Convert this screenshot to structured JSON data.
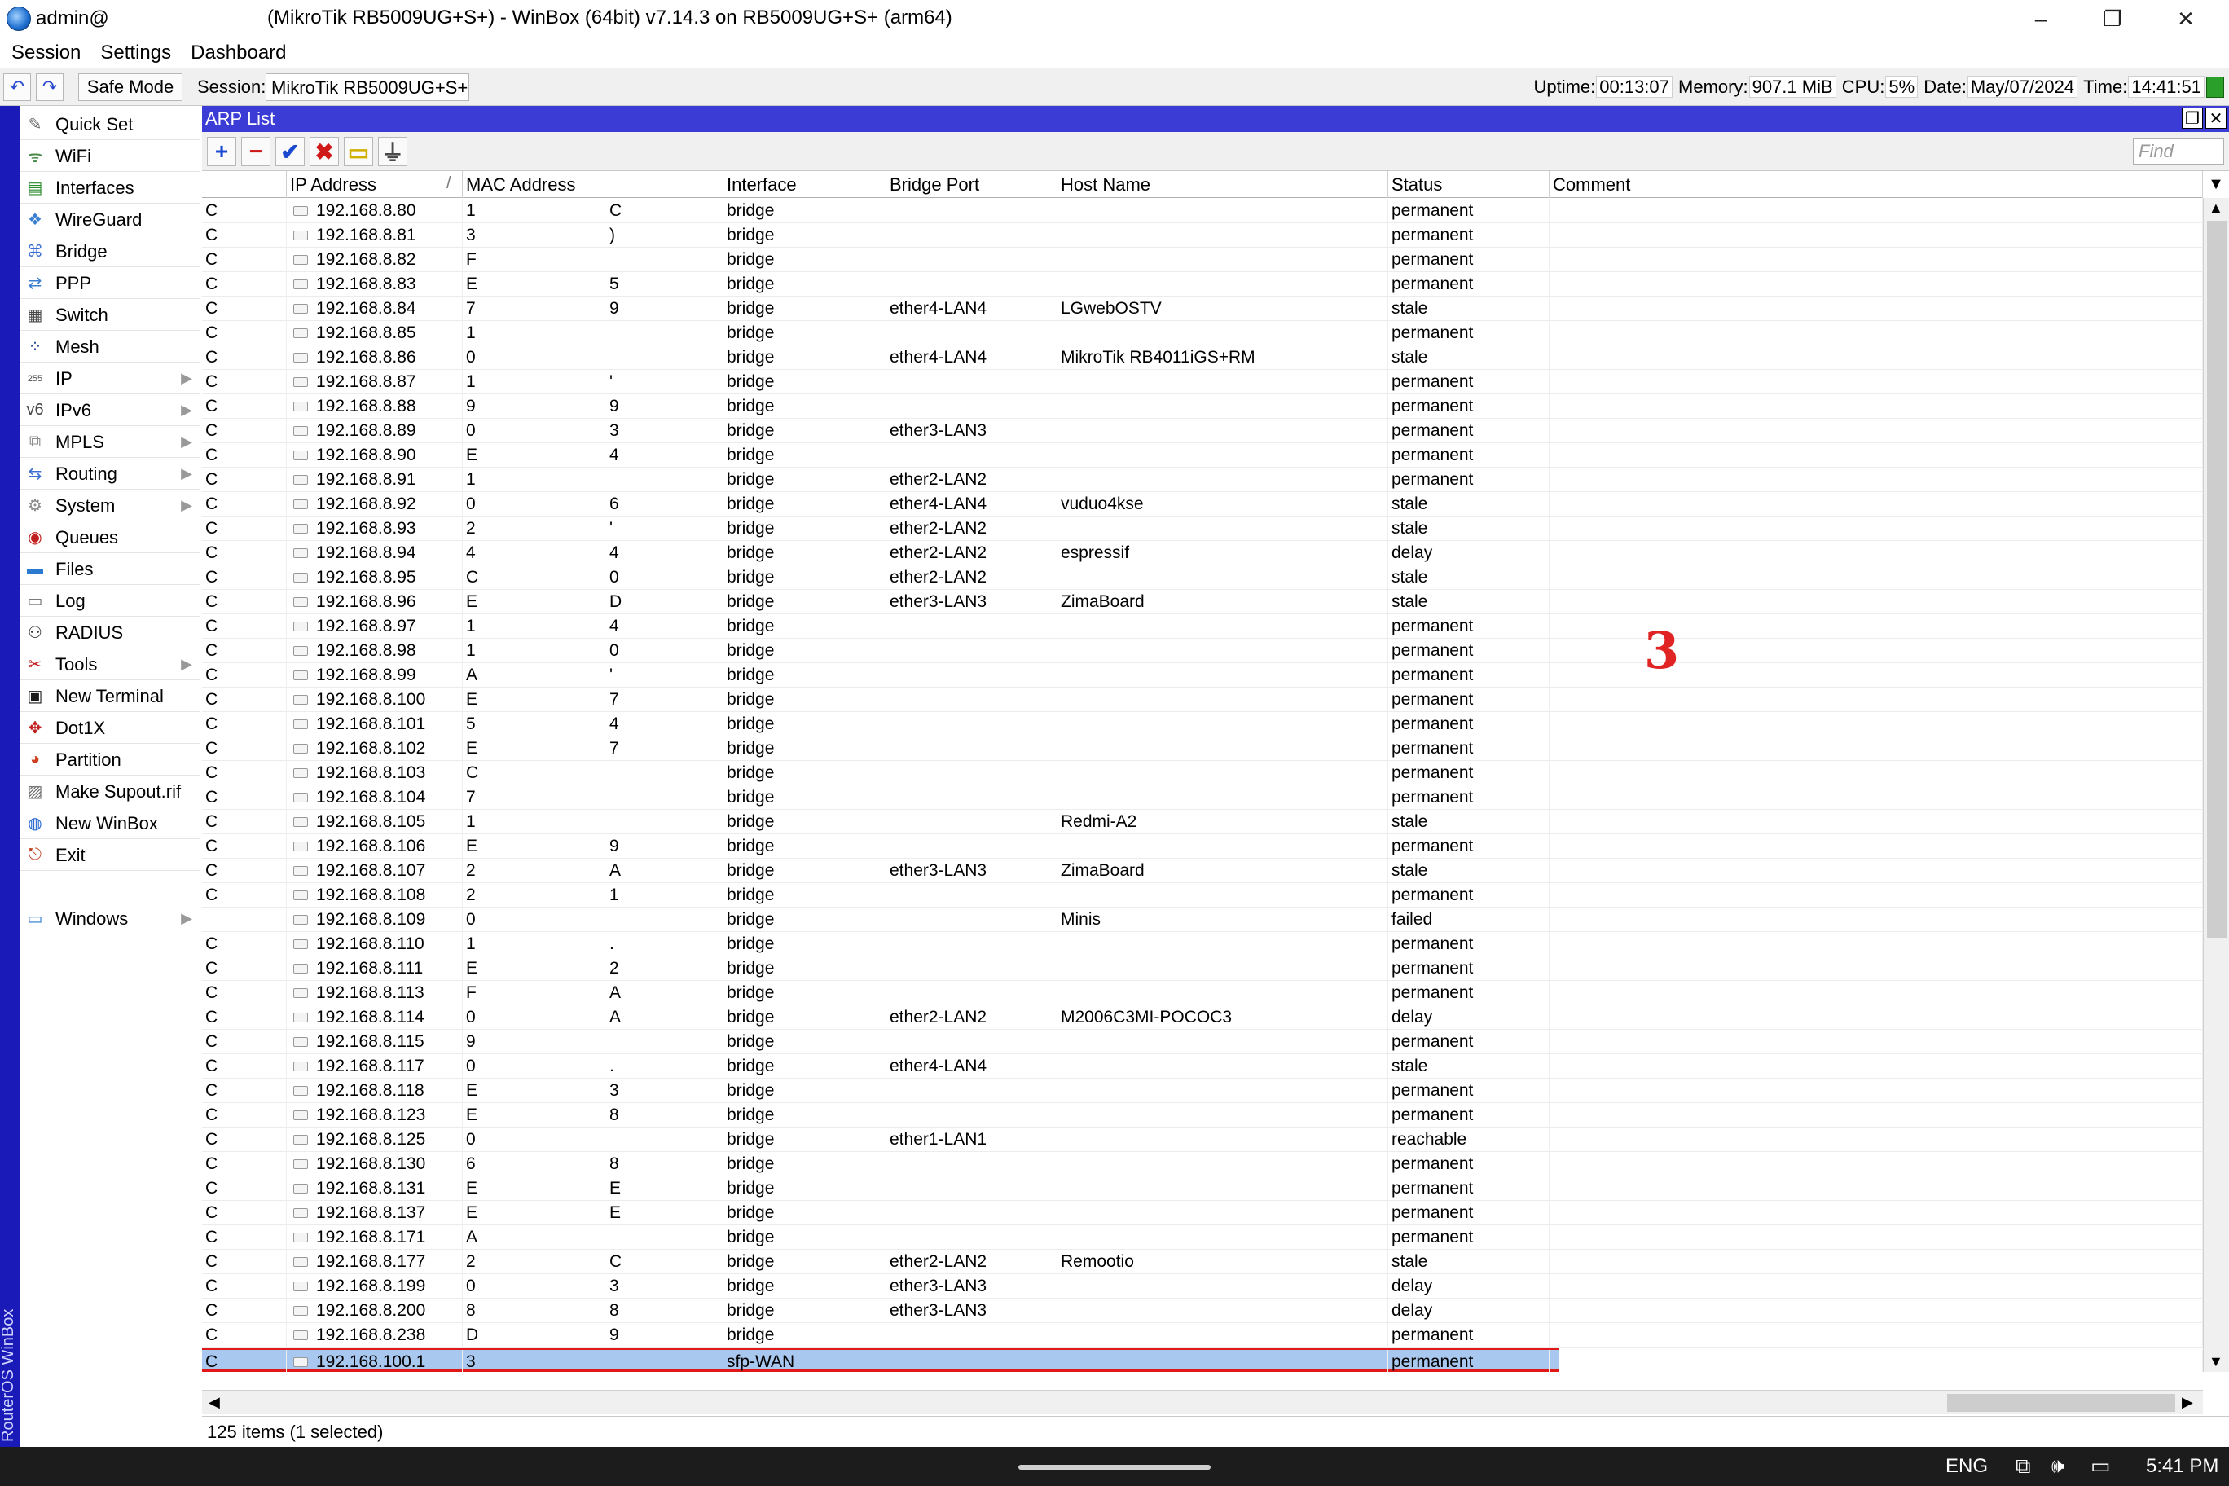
{
  "window": {
    "user": "admin@",
    "title": "(MikroTik RB5009UG+S+) - WinBox (64bit) v7.14.3 on RB5009UG+S+ (arm64)",
    "minimize": "–",
    "maximize": "❐",
    "close": "✕"
  },
  "menu": [
    "Session",
    "Settings",
    "Dashboard"
  ],
  "toolbar": {
    "undo": "↶",
    "redo": "↷",
    "safe_mode": "Safe Mode",
    "session_label": "Session:",
    "session_value": "MikroTik RB5009UG+S+",
    "uptime_label": "Uptime:",
    "uptime": "00:13:07",
    "memory_label": "Memory:",
    "memory": "907.1 MiB",
    "cpu_label": "CPU:",
    "cpu": "5%",
    "date_label": "Date:",
    "date": "May/07/2024",
    "time_label": "Time:",
    "time": "14:41:51",
    "led_color": "#2aa02a"
  },
  "side_stripe": "RouterOS WinBox",
  "sidebar": [
    {
      "label": "Quick Set",
      "icon": "quick-set-icon",
      "glyph": "✎",
      "color": "#6a6a6a",
      "submenu": false
    },
    {
      "label": "WiFi",
      "icon": "wifi-icon",
      "glyph": "ᯤ",
      "color": "#4a8a4a",
      "submenu": false
    },
    {
      "label": "Interfaces",
      "icon": "interfaces-icon",
      "glyph": "▤",
      "color": "#2b8a2b",
      "submenu": false
    },
    {
      "label": "WireGuard",
      "icon": "wireguard-icon",
      "glyph": "❖",
      "color": "#3b7fd0",
      "submenu": false
    },
    {
      "label": "Bridge",
      "icon": "bridge-icon",
      "glyph": "⌘",
      "color": "#3b6fd0",
      "submenu": false
    },
    {
      "label": "PPP",
      "icon": "ppp-icon",
      "glyph": "⇄",
      "color": "#3b7fd0",
      "submenu": false
    },
    {
      "label": "Switch",
      "icon": "switch-icon",
      "glyph": "▦",
      "color": "#4a4a4a",
      "submenu": false
    },
    {
      "label": "Mesh",
      "icon": "mesh-icon",
      "glyph": "⁘",
      "color": "#2a4aa0",
      "submenu": false
    },
    {
      "label": "IP",
      "icon": "ip-icon",
      "glyph": "255",
      "color": "#4a4a4a",
      "submenu": true
    },
    {
      "label": "IPv6",
      "icon": "ipv6-icon",
      "glyph": "v6",
      "color": "#4a4a4a",
      "submenu": true
    },
    {
      "label": "MPLS",
      "icon": "mpls-icon",
      "glyph": "⧉",
      "color": "#8a8a8a",
      "submenu": true
    },
    {
      "label": "Routing",
      "icon": "routing-icon",
      "glyph": "⇆",
      "color": "#3b6fd0",
      "submenu": true
    },
    {
      "label": "System",
      "icon": "system-icon",
      "glyph": "⚙",
      "color": "#8a8a8a",
      "submenu": true
    },
    {
      "label": "Queues",
      "icon": "queues-icon",
      "glyph": "◉",
      "color": "#c02020",
      "submenu": false
    },
    {
      "label": "Files",
      "icon": "files-icon",
      "glyph": "▬",
      "color": "#2a7ad0",
      "submenu": false
    },
    {
      "label": "Log",
      "icon": "log-icon",
      "glyph": "▭",
      "color": "#6a6a6a",
      "submenu": false
    },
    {
      "label": "RADIUS",
      "icon": "radius-icon",
      "glyph": "⚇",
      "color": "#3a3a3a",
      "submenu": false
    },
    {
      "label": "Tools",
      "icon": "tools-icon",
      "glyph": "✂",
      "color": "#c02020",
      "submenu": true
    },
    {
      "label": "New Terminal",
      "icon": "terminal-icon",
      "glyph": "▣",
      "color": "#1a1a1a",
      "submenu": false
    },
    {
      "label": "Dot1X",
      "icon": "dot1x-icon",
      "glyph": "✥",
      "color": "#c02020",
      "submenu": false
    },
    {
      "label": "Partition",
      "icon": "partition-icon",
      "glyph": "◕",
      "color": "#d04020",
      "submenu": false
    },
    {
      "label": "Make Supout.rif",
      "icon": "supout-icon",
      "glyph": "▨",
      "color": "#6a6a6a",
      "submenu": false
    },
    {
      "label": "New WinBox",
      "icon": "new-winbox-icon",
      "glyph": "◍",
      "color": "#2a6ad0",
      "submenu": false
    },
    {
      "label": "Exit",
      "icon": "exit-icon",
      "glyph": "⎋",
      "color": "#c04020",
      "submenu": false
    },
    {
      "label": "",
      "icon": "",
      "glyph": "",
      "color": "#000",
      "submenu": false
    },
    {
      "label": "Windows",
      "icon": "windows-icon",
      "glyph": "▭",
      "color": "#2a7ad0",
      "submenu": true
    }
  ],
  "arp": {
    "title": "ARP List",
    "restore": "❐",
    "close": "✕",
    "find_placeholder": "Find",
    "buttons": [
      {
        "name": "add-button",
        "glyph": "+",
        "color": "#1a4ad0"
      },
      {
        "name": "remove-button",
        "glyph": "−",
        "color": "#d01a1a"
      },
      {
        "name": "enable-button",
        "glyph": "✔",
        "color": "#1a4ad0"
      },
      {
        "name": "disable-button",
        "glyph": "✖",
        "color": "#d01a1a"
      },
      {
        "name": "comment-button",
        "glyph": "▭",
        "color": "#d0b000"
      },
      {
        "name": "filter-button",
        "glyph": "⏚",
        "color": "#4a4a4a"
      }
    ],
    "columns": [
      "",
      "IP Address",
      "MAC Address",
      "Interface",
      "Bridge Port",
      "Host Name",
      "Status",
      "Comment"
    ],
    "sort_mark": "/",
    "rows": [
      {
        "flag": "C",
        "ip": "192.168.8.80",
        "mac_start": "1",
        "mac_end": "C",
        "iface": "bridge",
        "port": "",
        "host": "",
        "status": "permanent"
      },
      {
        "flag": "C",
        "ip": "192.168.8.81",
        "mac_start": "3",
        "mac_end": ")",
        "iface": "bridge",
        "port": "",
        "host": "",
        "status": "permanent"
      },
      {
        "flag": "C",
        "ip": "192.168.8.82",
        "mac_start": "F",
        "mac_end": "",
        "iface": "bridge",
        "port": "",
        "host": "",
        "status": "permanent"
      },
      {
        "flag": "C",
        "ip": "192.168.8.83",
        "mac_start": "E",
        "mac_end": "5",
        "iface": "bridge",
        "port": "",
        "host": "",
        "status": "permanent"
      },
      {
        "flag": "C",
        "ip": "192.168.8.84",
        "mac_start": "7",
        "mac_end": "9",
        "iface": "bridge",
        "port": "ether4-LAN4",
        "host": "LGwebOSTV",
        "status": "stale"
      },
      {
        "flag": "C",
        "ip": "192.168.8.85",
        "mac_start": "1",
        "mac_end": "",
        "iface": "bridge",
        "port": "",
        "host": "",
        "status": "permanent"
      },
      {
        "flag": "C",
        "ip": "192.168.8.86",
        "mac_start": "0",
        "mac_end": "",
        "iface": "bridge",
        "port": "ether4-LAN4",
        "host": "MikroTik RB4011iGS+RM",
        "status": "stale"
      },
      {
        "flag": "C",
        "ip": "192.168.8.87",
        "mac_start": "1",
        "mac_end": "'",
        "iface": "bridge",
        "port": "",
        "host": "",
        "status": "permanent"
      },
      {
        "flag": "C",
        "ip": "192.168.8.88",
        "mac_start": "9",
        "mac_end": "9",
        "iface": "bridge",
        "port": "",
        "host": "",
        "status": "permanent"
      },
      {
        "flag": "C",
        "ip": "192.168.8.89",
        "mac_start": "0",
        "mac_end": "3",
        "iface": "bridge",
        "port": "ether3-LAN3",
        "host": "",
        "status": "permanent"
      },
      {
        "flag": "C",
        "ip": "192.168.8.90",
        "mac_start": "E",
        "mac_end": "4",
        "iface": "bridge",
        "port": "",
        "host": "",
        "status": "permanent"
      },
      {
        "flag": "C",
        "ip": "192.168.8.91",
        "mac_start": "1",
        "mac_end": "",
        "iface": "bridge",
        "port": "ether2-LAN2",
        "host": "",
        "status": "permanent"
      },
      {
        "flag": "C",
        "ip": "192.168.8.92",
        "mac_start": "0",
        "mac_end": "6",
        "iface": "bridge",
        "port": "ether4-LAN4",
        "host": "vuduo4kse",
        "status": "stale"
      },
      {
        "flag": "C",
        "ip": "192.168.8.93",
        "mac_start": "2",
        "mac_end": "'",
        "iface": "bridge",
        "port": "ether2-LAN2",
        "host": "",
        "status": "stale"
      },
      {
        "flag": "C",
        "ip": "192.168.8.94",
        "mac_start": "4",
        "mac_end": "4",
        "iface": "bridge",
        "port": "ether2-LAN2",
        "host": "espressif",
        "status": "delay"
      },
      {
        "flag": "C",
        "ip": "192.168.8.95",
        "mac_start": "C",
        "mac_end": "0",
        "iface": "bridge",
        "port": "ether2-LAN2",
        "host": "",
        "status": "stale"
      },
      {
        "flag": "C",
        "ip": "192.168.8.96",
        "mac_start": "E",
        "mac_end": "D",
        "iface": "bridge",
        "port": "ether3-LAN3",
        "host": "ZimaBoard",
        "status": "stale"
      },
      {
        "flag": "C",
        "ip": "192.168.8.97",
        "mac_start": "1",
        "mac_end": "4",
        "iface": "bridge",
        "port": "",
        "host": "",
        "status": "permanent"
      },
      {
        "flag": "C",
        "ip": "192.168.8.98",
        "mac_start": "1",
        "mac_end": "0",
        "iface": "bridge",
        "port": "",
        "host": "",
        "status": "permanent"
      },
      {
        "flag": "C",
        "ip": "192.168.8.99",
        "mac_start": "A",
        "mac_end": "'",
        "iface": "bridge",
        "port": "",
        "host": "",
        "status": "permanent"
      },
      {
        "flag": "C",
        "ip": "192.168.8.100",
        "mac_start": "E",
        "mac_end": "7",
        "iface": "bridge",
        "port": "",
        "host": "",
        "status": "permanent"
      },
      {
        "flag": "C",
        "ip": "192.168.8.101",
        "mac_start": "5",
        "mac_end": "4",
        "iface": "bridge",
        "port": "",
        "host": "",
        "status": "permanent"
      },
      {
        "flag": "C",
        "ip": "192.168.8.102",
        "mac_start": "E",
        "mac_end": "7",
        "iface": "bridge",
        "port": "",
        "host": "",
        "status": "permanent"
      },
      {
        "flag": "C",
        "ip": "192.168.8.103",
        "mac_start": "C",
        "mac_end": "",
        "iface": "bridge",
        "port": "",
        "host": "",
        "status": "permanent"
      },
      {
        "flag": "C",
        "ip": "192.168.8.104",
        "mac_start": "7",
        "mac_end": "",
        "iface": "bridge",
        "port": "",
        "host": "",
        "status": "permanent"
      },
      {
        "flag": "C",
        "ip": "192.168.8.105",
        "mac_start": "1",
        "mac_end": "",
        "iface": "bridge",
        "port": "",
        "host": "Redmi-A2",
        "status": "stale"
      },
      {
        "flag": "C",
        "ip": "192.168.8.106",
        "mac_start": "E",
        "mac_end": "9",
        "iface": "bridge",
        "port": "",
        "host": "",
        "status": "permanent"
      },
      {
        "flag": "C",
        "ip": "192.168.8.107",
        "mac_start": "2",
        "mac_end": "A",
        "iface": "bridge",
        "port": "ether3-LAN3",
        "host": "ZimaBoard",
        "status": "stale"
      },
      {
        "flag": "C",
        "ip": "192.168.8.108",
        "mac_start": "2",
        "mac_end": "1",
        "iface": "bridge",
        "port": "",
        "host": "",
        "status": "permanent"
      },
      {
        "flag": "",
        "ip": "192.168.8.109",
        "mac_start": "0",
        "mac_end": "",
        "iface": "bridge",
        "port": "",
        "host": "Minis",
        "status": "failed"
      },
      {
        "flag": "C",
        "ip": "192.168.8.110",
        "mac_start": "1",
        "mac_end": ".",
        "iface": "bridge",
        "port": "",
        "host": "",
        "status": "permanent"
      },
      {
        "flag": "C",
        "ip": "192.168.8.111",
        "mac_start": "E",
        "mac_end": "2",
        "iface": "bridge",
        "port": "",
        "host": "",
        "status": "permanent"
      },
      {
        "flag": "C",
        "ip": "192.168.8.113",
        "mac_start": "F",
        "mac_end": "A",
        "iface": "bridge",
        "port": "",
        "host": "",
        "status": "permanent"
      },
      {
        "flag": "C",
        "ip": "192.168.8.114",
        "mac_start": "0",
        "mac_end": "A",
        "iface": "bridge",
        "port": "ether2-LAN2",
        "host": "M2006C3MI-POCOC3",
        "status": "delay"
      },
      {
        "flag": "C",
        "ip": "192.168.8.115",
        "mac_start": "9",
        "mac_end": "",
        "iface": "bridge",
        "port": "",
        "host": "",
        "status": "permanent"
      },
      {
        "flag": "C",
        "ip": "192.168.8.117",
        "mac_start": "0",
        "mac_end": ".",
        "iface": "bridge",
        "port": "ether4-LAN4",
        "host": "",
        "status": "stale"
      },
      {
        "flag": "C",
        "ip": "192.168.8.118",
        "mac_start": "E",
        "mac_end": "3",
        "iface": "bridge",
        "port": "",
        "host": "",
        "status": "permanent"
      },
      {
        "flag": "C",
        "ip": "192.168.8.123",
        "mac_start": "E",
        "mac_end": "8",
        "iface": "bridge",
        "port": "",
        "host": "",
        "status": "permanent"
      },
      {
        "flag": "C",
        "ip": "192.168.8.125",
        "mac_start": "0",
        "mac_end": "",
        "iface": "bridge",
        "port": "ether1-LAN1",
        "host": "",
        "status": "reachable"
      },
      {
        "flag": "C",
        "ip": "192.168.8.130",
        "mac_start": "6",
        "mac_end": "8",
        "iface": "bridge",
        "port": "",
        "host": "",
        "status": "permanent"
      },
      {
        "flag": "C",
        "ip": "192.168.8.131",
        "mac_start": "E",
        "mac_end": "E",
        "iface": "bridge",
        "port": "",
        "host": "",
        "status": "permanent"
      },
      {
        "flag": "C",
        "ip": "192.168.8.137",
        "mac_start": "E",
        "mac_end": "E",
        "iface": "bridge",
        "port": "",
        "host": "",
        "status": "permanent"
      },
      {
        "flag": "C",
        "ip": "192.168.8.171",
        "mac_start": "A",
        "mac_end": "",
        "iface": "bridge",
        "port": "",
        "host": "",
        "status": "permanent"
      },
      {
        "flag": "C",
        "ip": "192.168.8.177",
        "mac_start": "2",
        "mac_end": "C",
        "iface": "bridge",
        "port": "ether2-LAN2",
        "host": "Remootio",
        "status": "stale"
      },
      {
        "flag": "C",
        "ip": "192.168.8.199",
        "mac_start": "0",
        "mac_end": "3",
        "iface": "bridge",
        "port": "ether3-LAN3",
        "host": "",
        "status": "delay"
      },
      {
        "flag": "C",
        "ip": "192.168.8.200",
        "mac_start": "8",
        "mac_end": "8",
        "iface": "bridge",
        "port": "ether3-LAN3",
        "host": "",
        "status": "delay"
      },
      {
        "flag": "C",
        "ip": "192.168.8.238",
        "mac_start": "D",
        "mac_end": "9",
        "iface": "bridge",
        "port": "",
        "host": "",
        "status": "permanent"
      },
      {
        "flag": "C",
        "ip": "192.168.100.1",
        "mac_start": "3",
        "mac_end": "",
        "iface": "sfp-WAN",
        "port": "",
        "host": "",
        "status": "permanent",
        "selected": true
      }
    ],
    "status_text": "125 items (1 selected)",
    "annotation": "3"
  },
  "taskbar": {
    "lang": "ENG",
    "time": "5:41 PM"
  }
}
